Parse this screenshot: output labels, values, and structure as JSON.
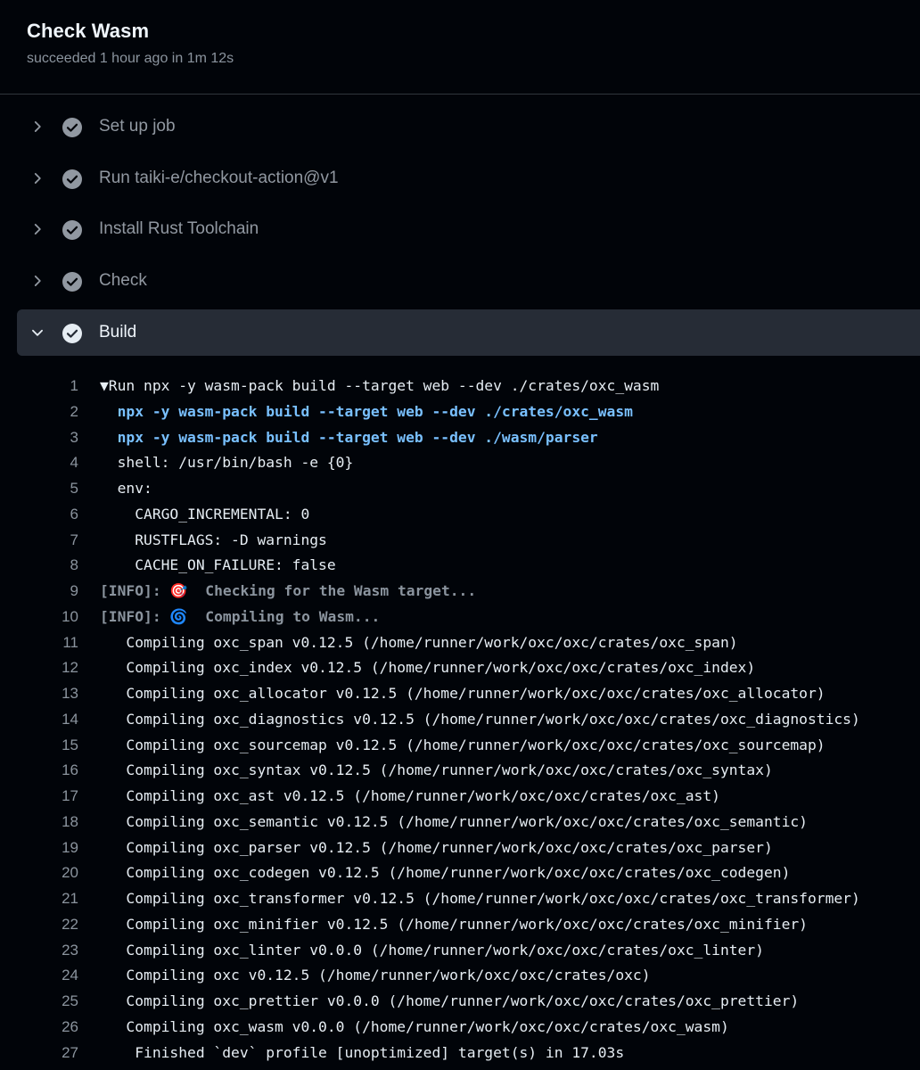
{
  "job": {
    "title": "Check Wasm",
    "status": "succeeded 1 hour ago in 1m 12s"
  },
  "steps": [
    {
      "label": "Set up job",
      "state": "success",
      "expanded": false
    },
    {
      "label": "Run taiki-e/checkout-action@v1",
      "state": "success",
      "expanded": false
    },
    {
      "label": "Install Rust Toolchain",
      "state": "success",
      "expanded": false
    },
    {
      "label": "Check",
      "state": "success",
      "expanded": false
    },
    {
      "label": "Build",
      "state": "success",
      "expanded": true
    }
  ],
  "log": [
    {
      "n": "1",
      "text": "▼Run npx -y wasm-pack build --target web --dev ./crates/oxc_wasm",
      "kind": "group"
    },
    {
      "n": "2",
      "text": "  npx -y wasm-pack build --target web --dev ./crates/oxc_wasm",
      "kind": "cmd"
    },
    {
      "n": "3",
      "text": "  npx -y wasm-pack build --target web --dev ./wasm/parser",
      "kind": "cmd"
    },
    {
      "n": "4",
      "text": "  shell: /usr/bin/bash -e {0}",
      "kind": "plain"
    },
    {
      "n": "5",
      "text": "  env:",
      "kind": "plain"
    },
    {
      "n": "6",
      "text": "    CARGO_INCREMENTAL: 0",
      "kind": "plain"
    },
    {
      "n": "7",
      "text": "    RUSTFLAGS: -D warnings",
      "kind": "plain"
    },
    {
      "n": "8",
      "text": "    CACHE_ON_FAILURE: false",
      "kind": "plain"
    },
    {
      "n": "9",
      "text": "[INFO]: 🎯  Checking for the Wasm target...",
      "kind": "info"
    },
    {
      "n": "10",
      "text": "[INFO]: 🌀  Compiling to Wasm...",
      "kind": "info"
    },
    {
      "n": "11",
      "text": "   Compiling oxc_span v0.12.5 (/home/runner/work/oxc/oxc/crates/oxc_span)",
      "kind": "plain"
    },
    {
      "n": "12",
      "text": "   Compiling oxc_index v0.12.5 (/home/runner/work/oxc/oxc/crates/oxc_index)",
      "kind": "plain"
    },
    {
      "n": "13",
      "text": "   Compiling oxc_allocator v0.12.5 (/home/runner/work/oxc/oxc/crates/oxc_allocator)",
      "kind": "plain"
    },
    {
      "n": "14",
      "text": "   Compiling oxc_diagnostics v0.12.5 (/home/runner/work/oxc/oxc/crates/oxc_diagnostics)",
      "kind": "plain"
    },
    {
      "n": "15",
      "text": "   Compiling oxc_sourcemap v0.12.5 (/home/runner/work/oxc/oxc/crates/oxc_sourcemap)",
      "kind": "plain"
    },
    {
      "n": "16",
      "text": "   Compiling oxc_syntax v0.12.5 (/home/runner/work/oxc/oxc/crates/oxc_syntax)",
      "kind": "plain"
    },
    {
      "n": "17",
      "text": "   Compiling oxc_ast v0.12.5 (/home/runner/work/oxc/oxc/crates/oxc_ast)",
      "kind": "plain"
    },
    {
      "n": "18",
      "text": "   Compiling oxc_semantic v0.12.5 (/home/runner/work/oxc/oxc/crates/oxc_semantic)",
      "kind": "plain"
    },
    {
      "n": "19",
      "text": "   Compiling oxc_parser v0.12.5 (/home/runner/work/oxc/oxc/crates/oxc_parser)",
      "kind": "plain"
    },
    {
      "n": "20",
      "text": "   Compiling oxc_codegen v0.12.5 (/home/runner/work/oxc/oxc/crates/oxc_codegen)",
      "kind": "plain"
    },
    {
      "n": "21",
      "text": "   Compiling oxc_transformer v0.12.5 (/home/runner/work/oxc/oxc/crates/oxc_transformer)",
      "kind": "plain"
    },
    {
      "n": "22",
      "text": "   Compiling oxc_minifier v0.12.5 (/home/runner/work/oxc/oxc/crates/oxc_minifier)",
      "kind": "plain"
    },
    {
      "n": "23",
      "text": "   Compiling oxc_linter v0.0.0 (/home/runner/work/oxc/oxc/crates/oxc_linter)",
      "kind": "plain"
    },
    {
      "n": "24",
      "text": "   Compiling oxc v0.12.5 (/home/runner/work/oxc/oxc/crates/oxc)",
      "kind": "plain"
    },
    {
      "n": "25",
      "text": "   Compiling oxc_prettier v0.0.0 (/home/runner/work/oxc/oxc/crates/oxc_prettier)",
      "kind": "plain"
    },
    {
      "n": "26",
      "text": "   Compiling oxc_wasm v0.0.0 (/home/runner/work/oxc/oxc/crates/oxc_wasm)",
      "kind": "plain"
    },
    {
      "n": "27",
      "text": "    Finished `dev` profile [unoptimized] target(s) in 17.03s",
      "kind": "plain"
    }
  ],
  "colors": {
    "background": "#010409",
    "expanded_row": "#262c36",
    "success_icon": "#9198a1",
    "command_text": "#79c0ff"
  },
  "icons": {
    "collapsed": "chevron-right-icon",
    "expanded": "chevron-down-icon",
    "success": "check-circle-icon"
  }
}
